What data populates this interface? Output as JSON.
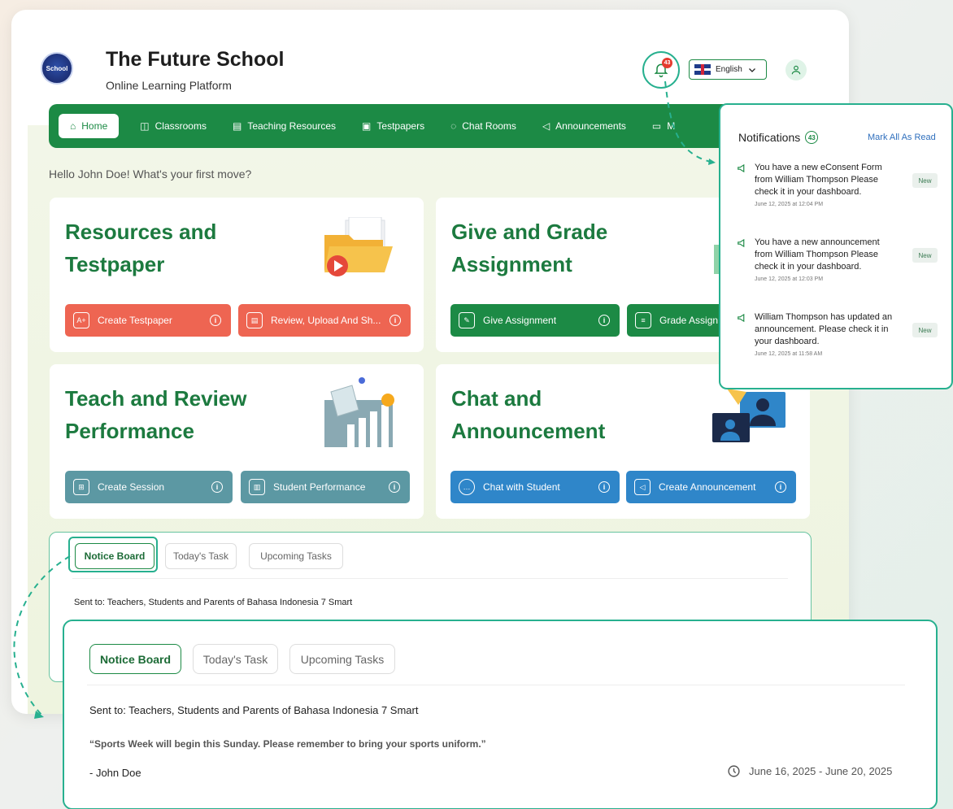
{
  "header": {
    "school_name": "The Future School",
    "tagline": "Online Learning Platform",
    "logo_text": "School",
    "notification_count": "43",
    "language": "English"
  },
  "nav": {
    "items": [
      {
        "label": "Home",
        "icon": "home-icon"
      },
      {
        "label": "Classrooms",
        "icon": "book-open-icon"
      },
      {
        "label": "Teaching Resources",
        "icon": "book-icon"
      },
      {
        "label": "Testpapers",
        "icon": "a-plus-icon"
      },
      {
        "label": "Chat Rooms",
        "icon": "chat-icon"
      },
      {
        "label": "Announcements",
        "icon": "megaphone-icon"
      },
      {
        "label": "M",
        "icon": "calendar-icon"
      }
    ]
  },
  "greeting": "Hello John Doe! What's your first move?",
  "cards": {
    "resources": {
      "title_line1": "Resources and",
      "title_line2": "Testpaper",
      "btn1": "Create Testpaper",
      "btn2": "Review, Upload And Sh..."
    },
    "assignment": {
      "title_line1": "Give and Grade",
      "title_line2": "Assignment",
      "btn1": "Give Assignment",
      "btn2": "Grade Assign"
    },
    "teach": {
      "title_line1": "Teach and Review",
      "title_line2": "Performance",
      "btn1": "Create Session",
      "btn2": "Student Performance"
    },
    "chat": {
      "title_line1": "Chat and",
      "title_line2": "Announcement",
      "btn1": "Chat with Student",
      "btn2": "Create Announcement"
    }
  },
  "notice_board": {
    "tabs": [
      "Notice Board",
      "Today's Task",
      "Upcoming Tasks"
    ],
    "sent_to": "Sent to: Teachers, Students and Parents of Bahasa Indonesia 7 Smart",
    "message": "“Sports Week will begin this Sunday. Please remember to bring your sports uniform.”",
    "author": "- John Doe",
    "date_range": "June 16, 2025 - June 20, 2025"
  },
  "notifications": {
    "title": "Notifications",
    "count": "43",
    "mark_all": "Mark All As Read",
    "items": [
      {
        "text": "You have a new eConsent Form from William Thompson Please check it in your dashboard.",
        "time": "June 12, 2025 at 12:04 PM",
        "badge": "New"
      },
      {
        "text": "You have a new announcement from William Thompson Please check it in your dashboard.",
        "time": "June 12, 2025 at 12:03 PM",
        "badge": "New"
      },
      {
        "text": "William Thompson has updated an announcement. Please check it in your dashboard.",
        "time": "June 12, 2025 at 11:58 AM",
        "badge": "New"
      }
    ]
  },
  "colors": {
    "brand_green": "#1c8a45",
    "accent_teal": "#27b08f",
    "red": "#ee6552",
    "slate_teal": "#5c98a3",
    "blue": "#2f86c9"
  }
}
